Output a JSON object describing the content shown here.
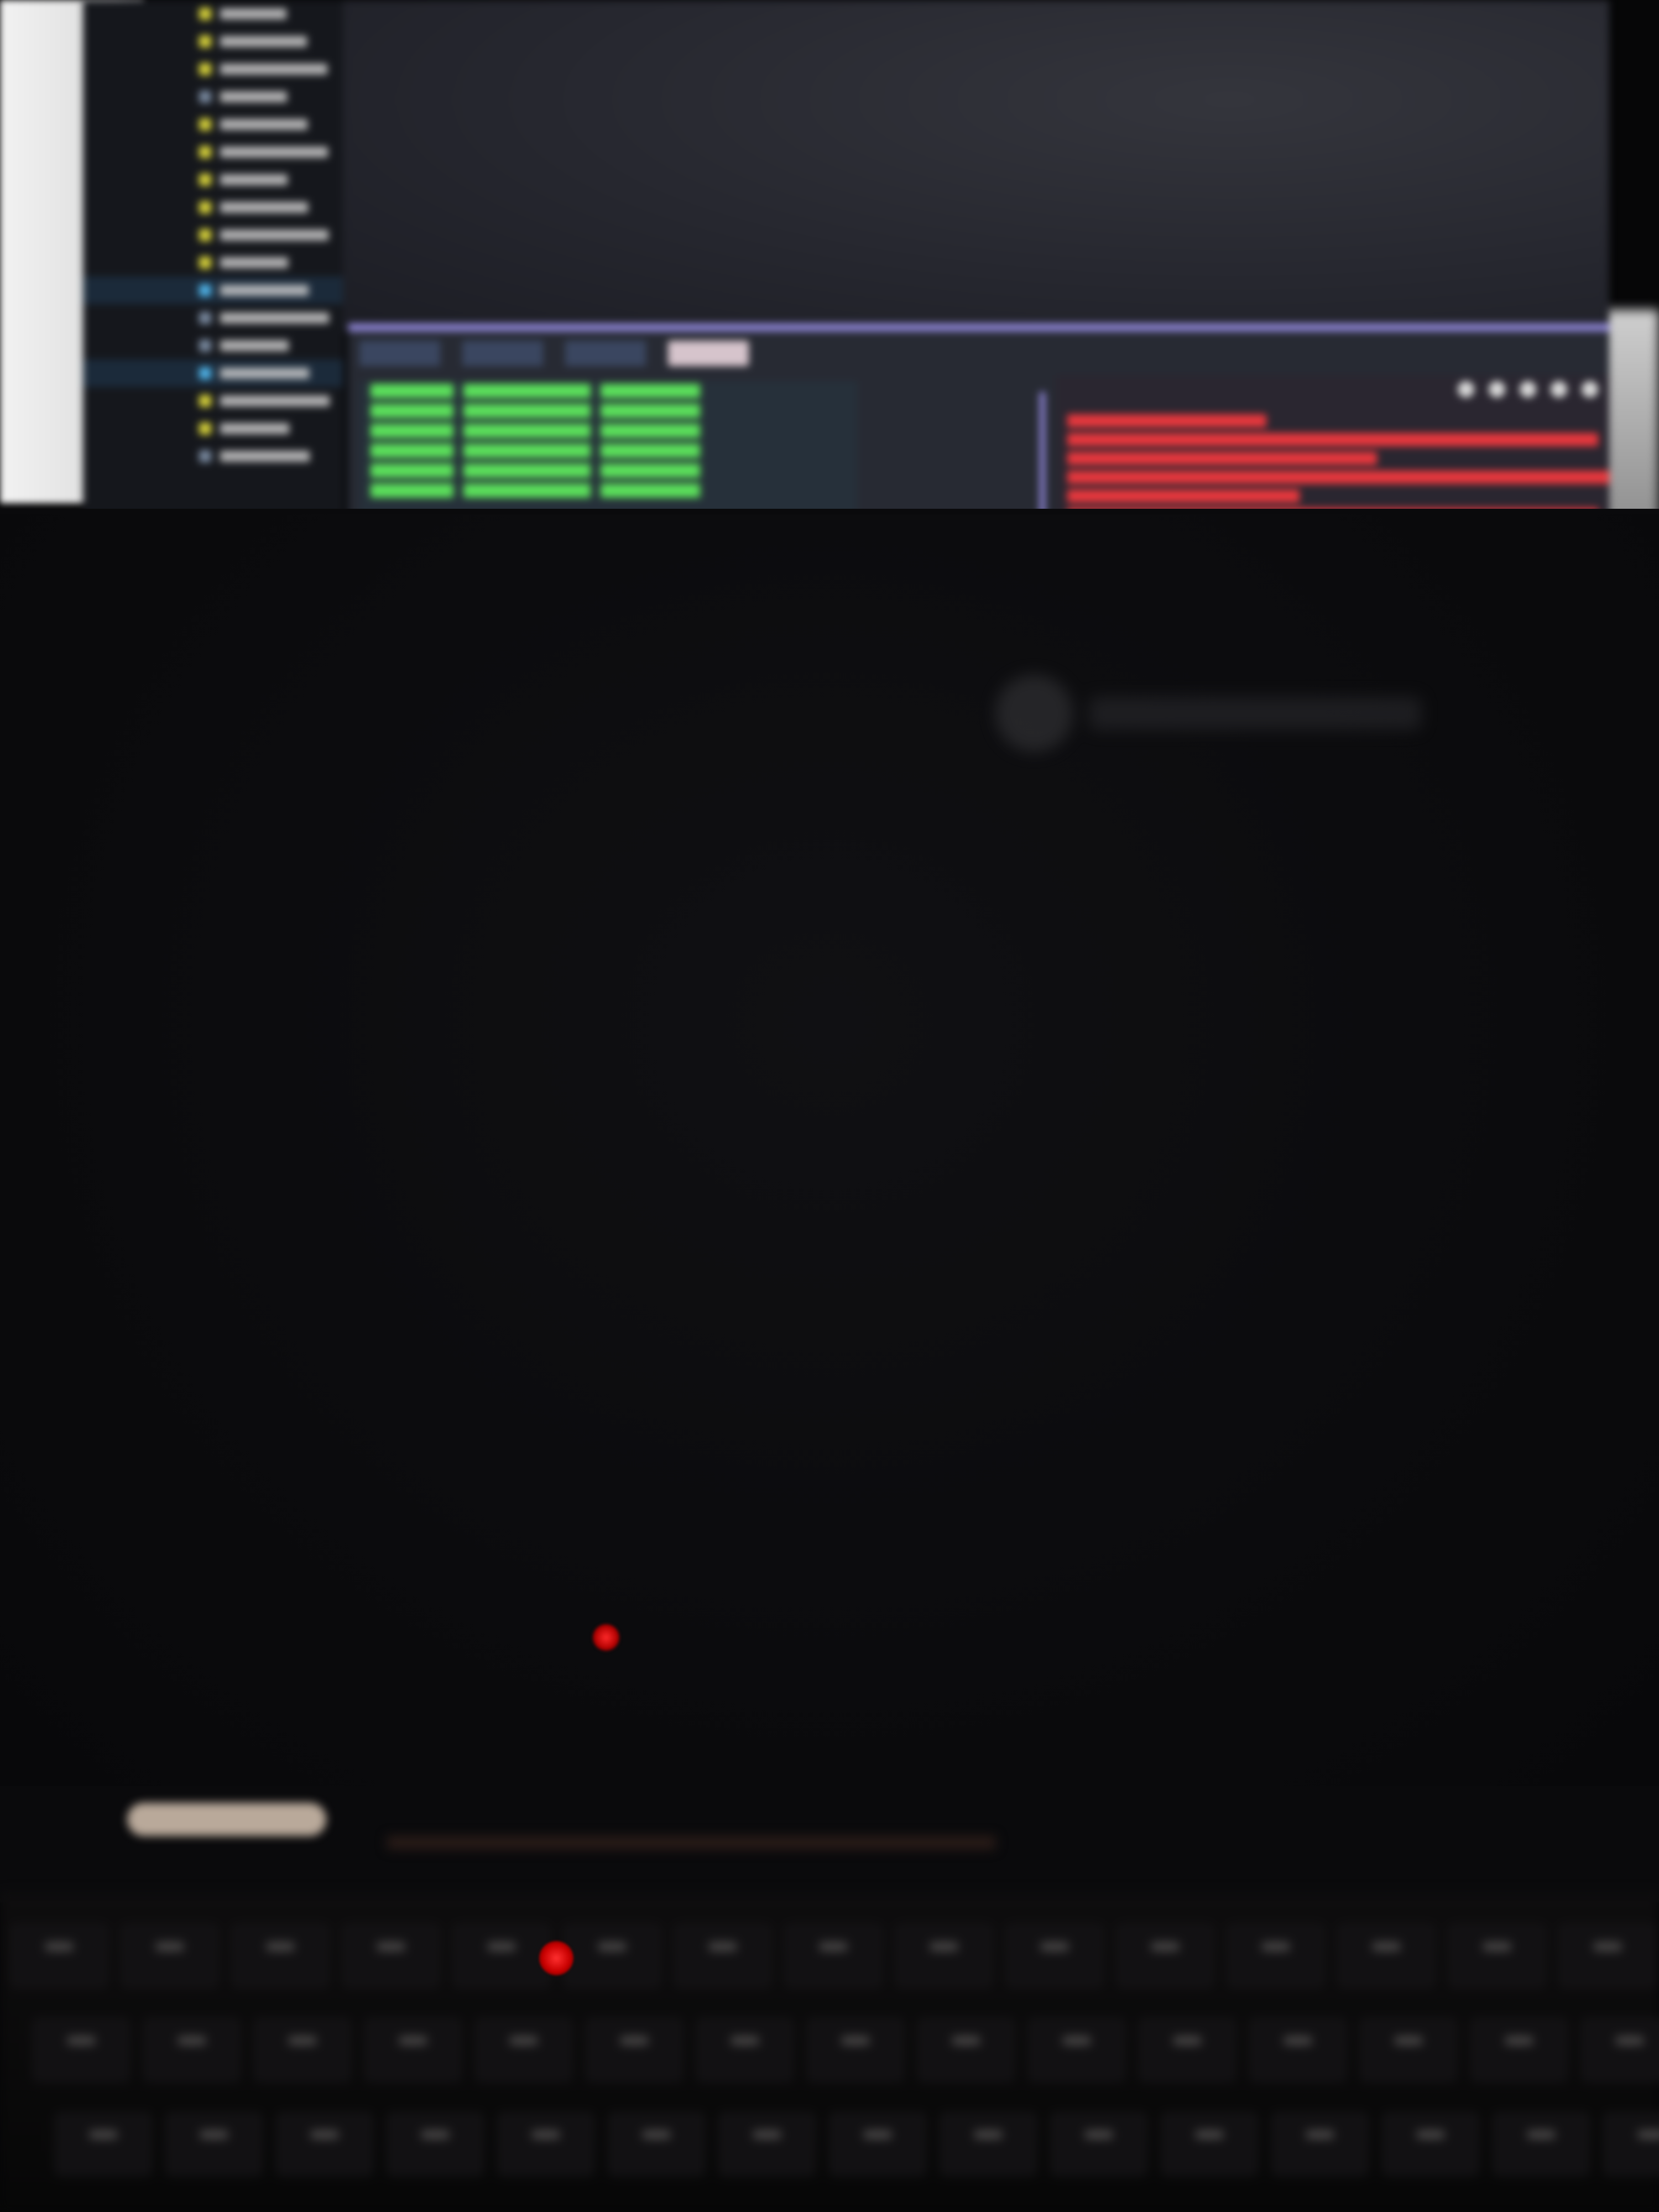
{
  "scene": {
    "description_colors": {
      "wall": "#f2f2f2",
      "monitor_bg": "#0c0d10",
      "desktop": "#2a2b33",
      "panel_border": "#8f86d8",
      "green_text": "#5be05b",
      "red_text": "#e8373d",
      "laptop_screen": "#0b0b0d",
      "led": "#ff2a2a",
      "hinge_bar": "#b9a99a"
    }
  },
  "monitor": {
    "file_tree": {
      "items": [
        {
          "icon": "folder-icon",
          "color": "#d9d43a",
          "label": ""
        },
        {
          "icon": "folder-icon",
          "color": "#d9d43a",
          "label": ""
        },
        {
          "icon": "folder-icon",
          "color": "#d9d43a",
          "label": ""
        },
        {
          "icon": "file-icon",
          "color": "#7a8aa0",
          "label": ""
        },
        {
          "icon": "folder-icon",
          "color": "#d9d43a",
          "label": ""
        },
        {
          "icon": "folder-icon",
          "color": "#d9d43a",
          "label": ""
        },
        {
          "icon": "folder-icon",
          "color": "#d9d43a",
          "label": ""
        },
        {
          "icon": "folder-icon",
          "color": "#d9d43a",
          "label": ""
        },
        {
          "icon": "folder-icon",
          "color": "#d9d43a",
          "label": ""
        },
        {
          "icon": "folder-icon",
          "color": "#d9d43a",
          "label": ""
        },
        {
          "icon": "file-icon",
          "color": "#4fb3e8",
          "label": ""
        },
        {
          "icon": "file-icon",
          "color": "#7a8aa0",
          "label": ""
        },
        {
          "icon": "file-icon",
          "color": "#7a8aa0",
          "label": ""
        },
        {
          "icon": "file-icon",
          "color": "#4fb3e8",
          "label": ""
        },
        {
          "icon": "folder-icon",
          "color": "#d9d43a",
          "label": ""
        },
        {
          "icon": "folder-icon",
          "color": "#d9d43a",
          "label": ""
        },
        {
          "icon": "file-icon",
          "color": "#7a8aa0",
          "label": ""
        }
      ]
    },
    "terminal": {
      "tabs": [
        {
          "label": "",
          "active": false
        },
        {
          "label": "",
          "active": false
        },
        {
          "label": "",
          "active": false
        },
        {
          "label": "",
          "active": true
        }
      ],
      "left_rows": 6,
      "right_lines": 6,
      "toolbar_icons": [
        "terminal-icon",
        "split-icon",
        "trash-icon",
        "chevron-up-icon",
        "close-icon"
      ]
    }
  },
  "laptop": {
    "screen_on": false,
    "led_state": "red",
    "logo": "manufacturer-logo"
  }
}
